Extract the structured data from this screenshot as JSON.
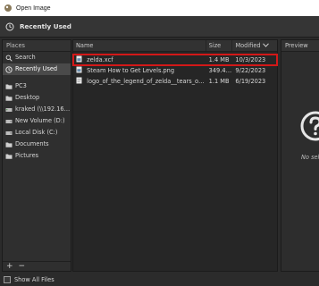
{
  "window": {
    "title": "Open Image"
  },
  "header": {
    "location": "Recently Used"
  },
  "places": {
    "header": "Places",
    "items": [
      {
        "label": "Search",
        "icon": "search-icon",
        "selected": false
      },
      {
        "label": "Recently Used",
        "icon": "clock-icon",
        "selected": true
      },
      {
        "label": "PC3",
        "icon": "folder-icon",
        "selected": false
      },
      {
        "label": "Desktop",
        "icon": "folder-icon",
        "selected": false
      },
      {
        "label": "kraked (\\\\192.168....",
        "icon": "network-drive-icon",
        "selected": false
      },
      {
        "label": "New Volume (D:)",
        "icon": "drive-icon",
        "selected": false
      },
      {
        "label": "Local Disk (C:)",
        "icon": "drive-icon",
        "selected": false
      },
      {
        "label": "Documents",
        "icon": "folder-icon",
        "selected": false
      },
      {
        "label": "Pictures",
        "icon": "folder-icon",
        "selected": false
      }
    ],
    "add_label": "+",
    "remove_label": "−"
  },
  "files": {
    "columns": {
      "name": "Name",
      "size": "Size",
      "modified": "Modified"
    },
    "rows": [
      {
        "name": "zelda.xcf",
        "size": "1.4 MB",
        "modified": "10/3/2023",
        "highlighted": true
      },
      {
        "name": "Steam How to Get Levels.png",
        "size": "349.4 kB",
        "modified": "9/22/2023",
        "highlighted": false
      },
      {
        "name": "logo_of_the_legend_of_zelda__tears_of_the_...",
        "size": "1.1 MB",
        "modified": "6/19/2023",
        "highlighted": false
      }
    ]
  },
  "preview": {
    "header": "Preview",
    "no_selection": "No sel"
  },
  "footer": {
    "show_all_files": "Show All Files"
  },
  "colors": {
    "highlight_border": "#d31818",
    "selected_place": "#4a4a4a"
  }
}
